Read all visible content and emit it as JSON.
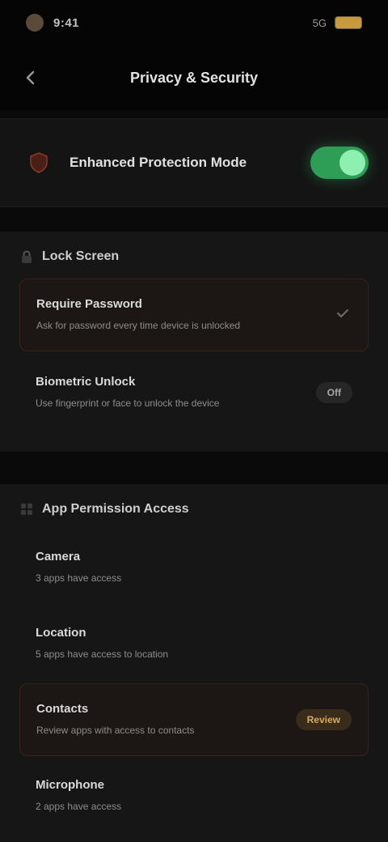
{
  "status_bar": {
    "time": "9:41",
    "right_text": "5G"
  },
  "header": {
    "title": "Privacy & Security"
  },
  "toggle_card": {
    "label": "Enhanced Protection Mode",
    "state": "on"
  },
  "section1": {
    "title": "Lock Screen",
    "options": [
      {
        "title": "Require Password",
        "desc": "Ask for password every time device is unlocked",
        "selected": true
      },
      {
        "title": "Biometric Unlock",
        "desc": "Use fingerprint or face to unlock the device",
        "badge": "Off",
        "selected": false
      }
    ]
  },
  "section2": {
    "title": "App Permission Access",
    "options": [
      {
        "title": "Camera",
        "desc": "3 apps have access"
      },
      {
        "title": "Location",
        "desc": "5 apps have access to location"
      },
      {
        "title": "Contacts",
        "desc": "Review apps with access to contacts",
        "badge": "Review",
        "selected": true
      },
      {
        "title": "Microphone",
        "desc": "2 apps have access"
      }
    ]
  },
  "colors": {
    "accent_green": "#2e9e56",
    "accent_warn": "#d8aa5a",
    "selected_border": "#3a2218",
    "background": "#0a0a0a"
  }
}
